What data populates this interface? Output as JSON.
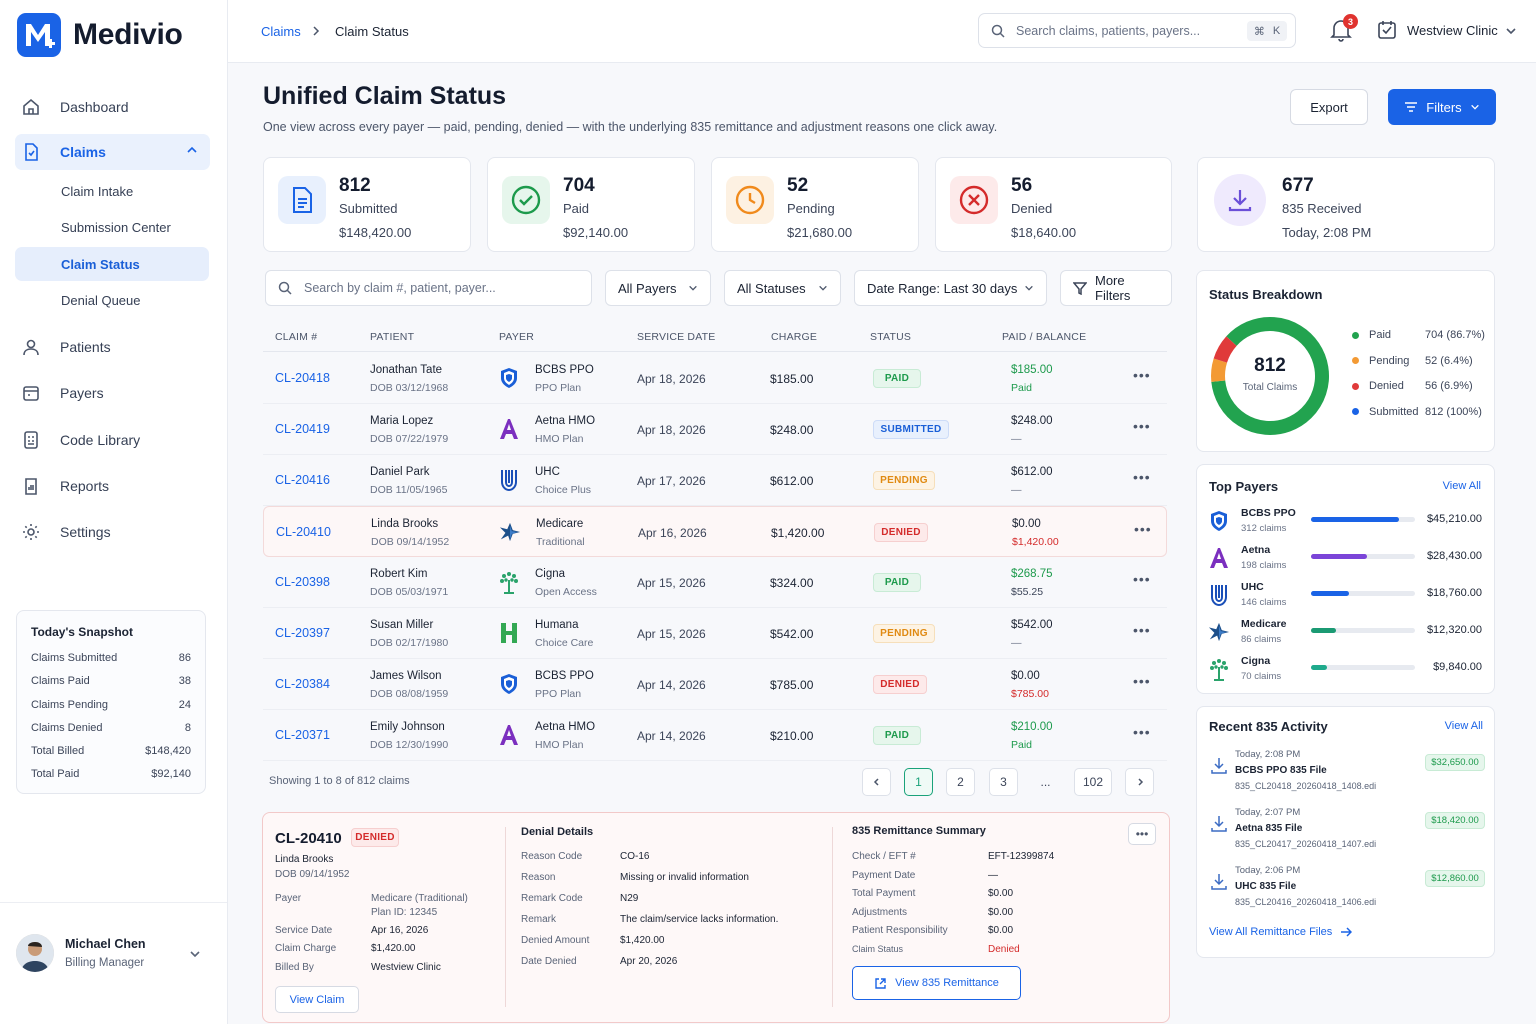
{
  "app": {
    "name": "Medivio"
  },
  "sidebar": {
    "nav": {
      "dashboard": "Dashboard",
      "claims": "Claims",
      "patients": "Patients",
      "payers": "Payers",
      "code_library": "Code Library",
      "reports": "Reports",
      "settings": "Settings"
    },
    "claims_sub": [
      "Claim Intake",
      "Submission Center",
      "Claim Status",
      "Denial Queue"
    ],
    "snapshot": {
      "title": "Today's Snapshot",
      "rows": [
        {
          "label": "Claims Submitted",
          "value": "86"
        },
        {
          "label": "Claims Paid",
          "value": "38"
        },
        {
          "label": "Claims Pending",
          "value": "24"
        },
        {
          "label": "Claims Denied",
          "value": "8"
        },
        {
          "label": "Total Billed",
          "value": "$148,420"
        },
        {
          "label": "Total Paid",
          "value": "$92,140"
        }
      ]
    },
    "user": {
      "name": "Michael Chen",
      "role": "Billing Manager"
    }
  },
  "topbar": {
    "breadcrumb": [
      "Claims",
      "Claim Status"
    ],
    "search_placeholder": "Search claims, patients, payers...",
    "kbd": [
      "⌘",
      "K"
    ],
    "notifications": "3",
    "clinic": "Westview Clinic"
  },
  "header": {
    "title": "Unified Claim Status",
    "subtitle": "One view across every payer — paid, pending, denied — with the underlying 835 remittance and adjustment reasons one click away.",
    "export": "Export",
    "filters": "Filters"
  },
  "stats": [
    {
      "num": "812",
      "label": "Submitted",
      "amount": "$148,420.00",
      "icon": "document-icon",
      "color": "#1a63e6"
    },
    {
      "num": "704",
      "label": "Paid",
      "amount": "$92,140.00",
      "icon": "check-circle-icon",
      "color": "#1d9a4c"
    },
    {
      "num": "52",
      "label": "Pending",
      "amount": "$21,680.00",
      "icon": "clock-icon",
      "color": "#f08a1c"
    },
    {
      "num": "56",
      "label": "Denied",
      "amount": "$18,640.00",
      "icon": "x-circle-icon",
      "color": "#d42b2b"
    },
    {
      "num": "677",
      "label": "835 Received",
      "amount": "Today, 2:08 PM",
      "icon": "download-icon",
      "color": "#6b4fd8"
    }
  ],
  "filters": {
    "search_placeholder": "Search by claim #, patient, payer...",
    "payers": "All Payers",
    "statuses": "All Statuses",
    "date_range": "Date Range: Last 30 days",
    "more": "More Filters"
  },
  "table": {
    "headers": [
      "CLAIM #",
      "PATIENT",
      "PAYER",
      "SERVICE DATE",
      "CHARGE",
      "STATUS",
      "PAID / BALANCE"
    ],
    "rows": [
      {
        "id": "CL-20418",
        "patient": "Jonathan Tate",
        "dob": "DOB 03/12/1968",
        "payer": "BCBS PPO",
        "plan": "PPO Plan",
        "payer_icon": "bcbs",
        "date": "Apr 18, 2026",
        "charge": "$185.00",
        "status": "PAID",
        "paid": "$185.00",
        "balance": "Paid"
      },
      {
        "id": "CL-20419",
        "patient": "Maria Lopez",
        "dob": "DOB 07/22/1979",
        "payer": "Aetna HMO",
        "plan": "HMO Plan",
        "payer_icon": "aetna",
        "date": "Apr 18, 2026",
        "charge": "$248.00",
        "status": "SUBMITTED",
        "paid": "$248.00",
        "balance": "—"
      },
      {
        "id": "CL-20416",
        "patient": "Daniel Park",
        "dob": "DOB 11/05/1965",
        "payer": "UHC",
        "plan": "Choice Plus",
        "payer_icon": "uhc",
        "date": "Apr 17, 2026",
        "charge": "$612.00",
        "status": "PENDING",
        "paid": "$612.00",
        "balance": "—"
      },
      {
        "id": "CL-20410",
        "patient": "Linda Brooks",
        "dob": "DOB 09/14/1952",
        "payer": "Medicare",
        "plan": "Traditional",
        "payer_icon": "medicare",
        "date": "Apr 16, 2026",
        "charge": "$1,420.00",
        "status": "DENIED",
        "paid": "$0.00",
        "balance": "$1,420.00"
      },
      {
        "id": "CL-20398",
        "patient": "Robert Kim",
        "dob": "DOB 05/03/1971",
        "payer": "Cigna",
        "plan": "Open Access",
        "payer_icon": "cigna",
        "date": "Apr 15, 2026",
        "charge": "$324.00",
        "status": "PAID",
        "paid": "$268.75",
        "balance": "$55.25"
      },
      {
        "id": "CL-20397",
        "patient": "Susan Miller",
        "dob": "DOB 02/17/1980",
        "payer": "Humana",
        "plan": "Choice Care",
        "payer_icon": "humana",
        "date": "Apr 15, 2026",
        "charge": "$542.00",
        "status": "PENDING",
        "paid": "$542.00",
        "balance": "—"
      },
      {
        "id": "CL-20384",
        "patient": "James Wilson",
        "dob": "DOB 08/08/1959",
        "payer": "BCBS PPO",
        "plan": "PPO Plan",
        "payer_icon": "bcbs",
        "date": "Apr 14, 2026",
        "charge": "$785.00",
        "status": "DENIED",
        "paid": "$0.00",
        "balance": "$785.00"
      },
      {
        "id": "CL-20371",
        "patient": "Emily Johnson",
        "dob": "DOB 12/30/1990",
        "payer": "Aetna HMO",
        "plan": "HMO Plan",
        "payer_icon": "aetna",
        "date": "Apr 14, 2026",
        "charge": "$210.00",
        "status": "PAID",
        "paid": "$210.00",
        "balance": "Paid"
      }
    ],
    "showing": "Showing 1 to 8 of 812 claims",
    "pages": [
      "1",
      "2",
      "3",
      "...",
      "102"
    ]
  },
  "detail": {
    "claim_id": "CL-20410",
    "status": "DENIED",
    "patient": "Linda Brooks",
    "dob": "DOB 09/14/1952",
    "payer_label": "Payer",
    "payer_value": "Medicare (Traditional)",
    "plan_id": "Plan ID: 12345",
    "service_date_label": "Service Date",
    "service_date": "Apr 16, 2026",
    "charge_label": "Claim Charge",
    "charge": "$1,420.00",
    "billed_by_label": "Billed By",
    "billed_by": "Westview Clinic",
    "view_claim": "View Claim",
    "denial": {
      "title": "Denial Details",
      "rows": [
        {
          "label": "Reason Code",
          "value": "CO-16"
        },
        {
          "label": "Reason",
          "value": "Missing or invalid information"
        },
        {
          "label": "Remark Code",
          "value": "N29"
        },
        {
          "label": "Remark",
          "value": "The claim/service lacks information."
        },
        {
          "label": "Denied Amount",
          "value": "$1,420.00"
        },
        {
          "label": "Date Denied",
          "value": "Apr 20, 2026"
        }
      ]
    },
    "remit": {
      "title": "835 Remittance Summary",
      "rows": [
        {
          "label": "Check / EFT #",
          "value": "EFT-12399874"
        },
        {
          "label": "Payment Date",
          "value": "—"
        },
        {
          "label": "Total Payment",
          "value": "$0.00"
        },
        {
          "label": "Adjustments",
          "value": "$0.00"
        },
        {
          "label": "Patient Responsibility",
          "value": "$0.00"
        },
        {
          "label": "Claim Status",
          "value": "Denied"
        }
      ],
      "button": "View 835 Remittance"
    }
  },
  "breakdown": {
    "title": "Status Breakdown",
    "total": "812",
    "total_label": "Total Claims",
    "items": [
      {
        "label": "Paid",
        "value": "704 (86.7%)",
        "color": "#22a34f"
      },
      {
        "label": "Pending",
        "value": "52 (6.4%)",
        "color": "#f39a34"
      },
      {
        "label": "Denied",
        "value": "56 (6.9%)",
        "color": "#e03a3a"
      },
      {
        "label": "Submitted",
        "value": "812 (100%)",
        "color": "#1a63e6"
      }
    ],
    "donut": [
      {
        "name": "Paid",
        "value": 704
      },
      {
        "name": "Pending",
        "value": 52
      },
      {
        "name": "Denied",
        "value": 56
      }
    ]
  },
  "top_payers": {
    "title": "Top Payers",
    "view_all": "View All",
    "items": [
      {
        "name": "BCBS PPO",
        "claims": "312 claims",
        "amount": "$45,210.00",
        "fill": 0.85,
        "color": "#1a63e6",
        "icon": "bcbs"
      },
      {
        "name": "Aetna",
        "claims": "198 claims",
        "amount": "$28,430.00",
        "fill": 0.54,
        "color": "#7b45d8",
        "icon": "aetna"
      },
      {
        "name": "UHC",
        "claims": "146 claims",
        "amount": "$18,760.00",
        "fill": 0.37,
        "color": "#1a63e6",
        "icon": "uhc"
      },
      {
        "name": "Medicare",
        "claims": "86 claims",
        "amount": "$12,320.00",
        "fill": 0.24,
        "color": "#1b9a73",
        "icon": "medicare"
      },
      {
        "name": "Cigna",
        "claims": "70 claims",
        "amount": "$9,840.00",
        "fill": 0.15,
        "color": "#1faa8c",
        "icon": "cigna"
      }
    ]
  },
  "recent": {
    "title": "Recent 835 Activity",
    "view_all": "View All",
    "items": [
      {
        "time": "Today, 2:08 PM",
        "name": "BCBS PPO 835 File",
        "file": "835_CL20418_20260418_1408.edi",
        "amount": "$32,650.00"
      },
      {
        "time": "Today, 2:07 PM",
        "name": "Aetna 835 File",
        "file": "835_CL20417_20260418_1407.edi",
        "amount": "$18,420.00"
      },
      {
        "time": "Today, 2:06 PM",
        "name": "UHC 835 File",
        "file": "835_CL20416_20260418_1406.edi",
        "amount": "$12,860.00"
      }
    ],
    "footer_link": "View All Remittance Files"
  }
}
